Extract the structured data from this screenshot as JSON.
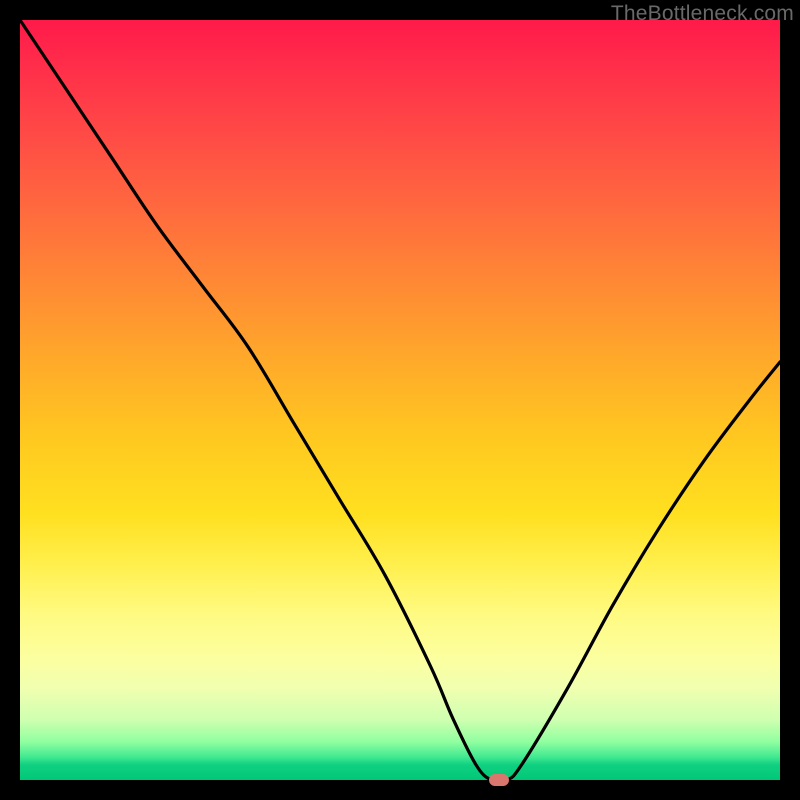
{
  "watermark": "TheBottleneck.com",
  "chart_data": {
    "type": "line",
    "title": "",
    "xlabel": "",
    "ylabel": "",
    "xlim": [
      0,
      100
    ],
    "ylim": [
      0,
      100
    ],
    "grid": false,
    "legend": false,
    "background_gradient": {
      "top": "#ff1a4a",
      "mid": "#ffe020",
      "bottom": "#00c878"
    },
    "series": [
      {
        "name": "bottleneck-curve",
        "color": "#000000",
        "x": [
          0,
          6,
          12,
          18,
          24,
          30,
          36,
          42,
          48,
          54,
          57,
          60,
          62,
          64,
          66,
          72,
          78,
          84,
          90,
          96,
          100
        ],
        "values": [
          100,
          91,
          82,
          73,
          65,
          57,
          47,
          37,
          27,
          15,
          8,
          2,
          0,
          0,
          2,
          12,
          23,
          33,
          42,
          50,
          55
        ]
      }
    ],
    "marker": {
      "name": "optimal-point",
      "x": 63,
      "y": 0,
      "color": "#d9776e",
      "shape": "pill"
    }
  }
}
